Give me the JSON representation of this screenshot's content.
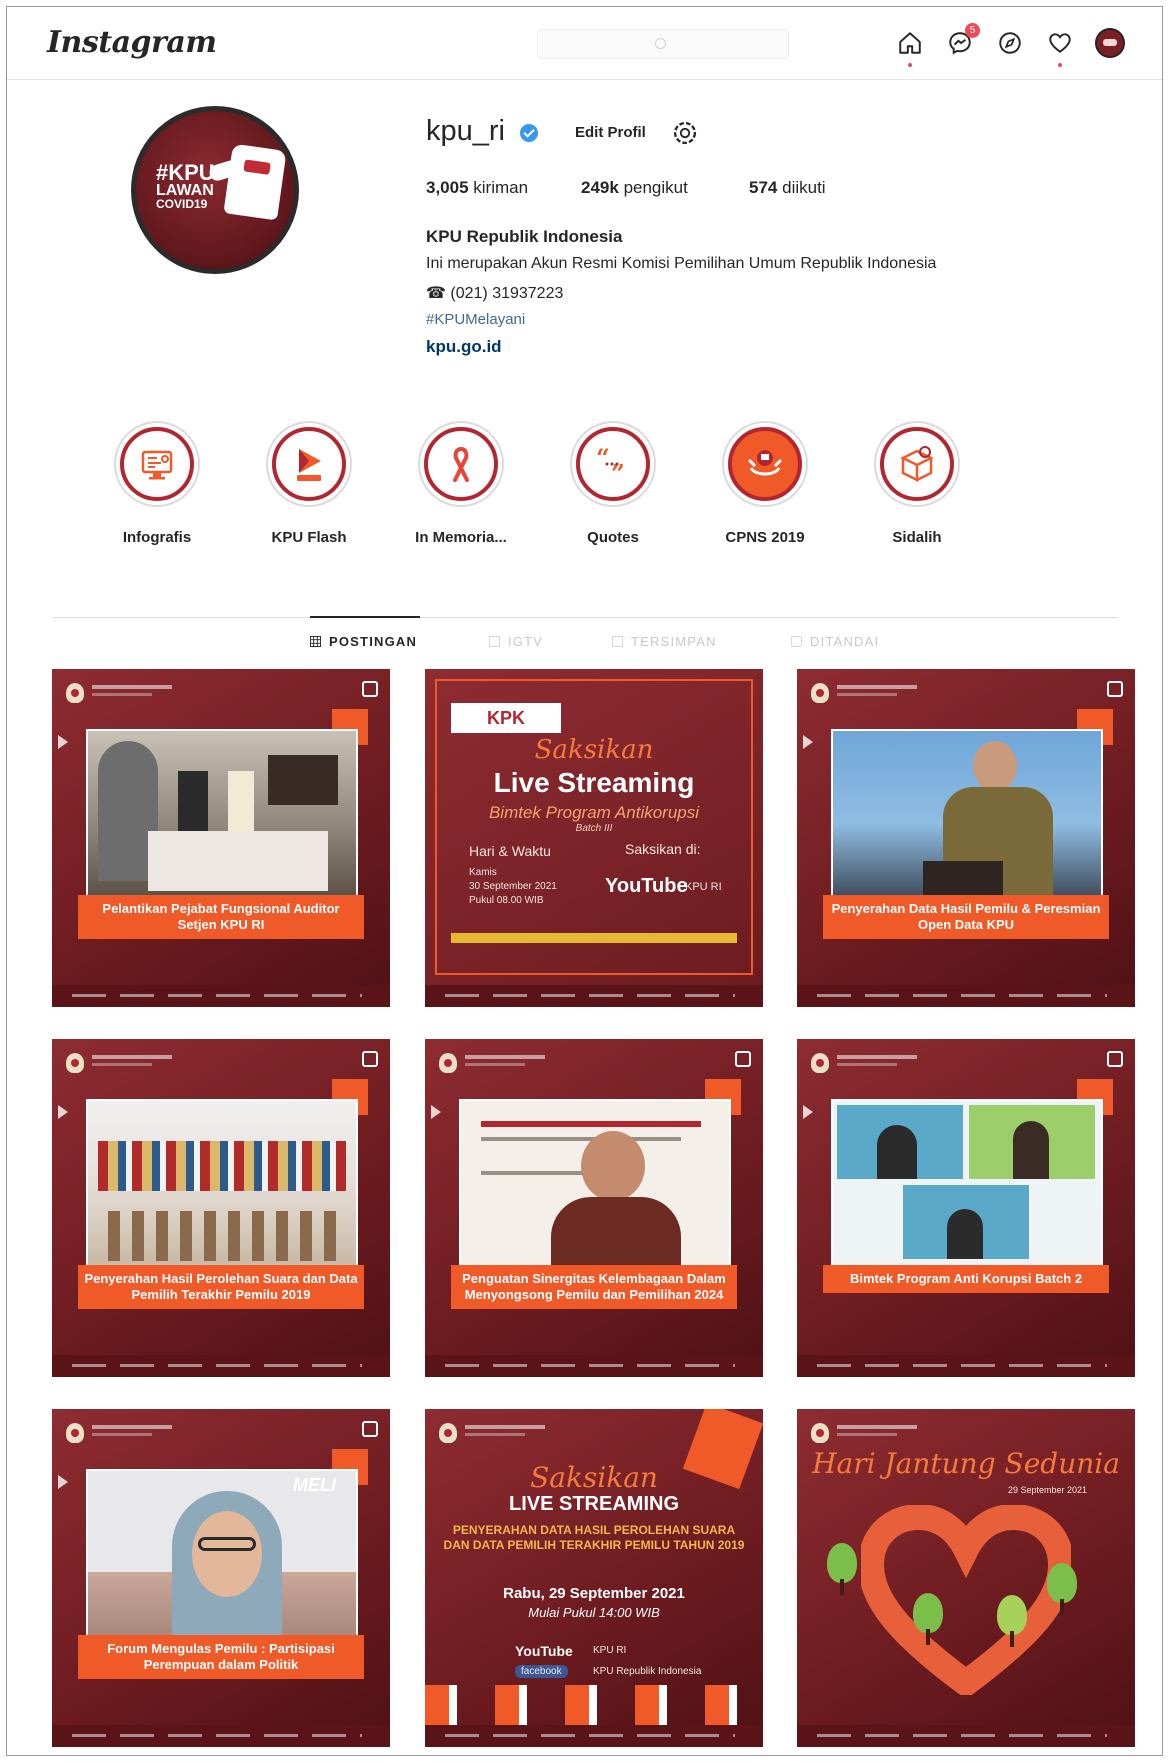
{
  "app": {
    "logo": "Instagram",
    "search_placeholder": ""
  },
  "nav": {
    "messages_badge": "5"
  },
  "profile": {
    "username": "kpu_ri",
    "edit_label": "Edit Profil",
    "avatar_lines": [
      "#KPU",
      "LAWAN",
      "COVID19"
    ],
    "posts_count": "3,005",
    "posts_label": "kiriman",
    "followers_count": "249k",
    "followers_label": "pengikut",
    "following_count": "574",
    "following_label": "diikuti",
    "name": "KPU Republik Indonesia",
    "description": "Ini merupakan Akun Resmi Komisi Pemilihan Umum Republik Indonesia",
    "phone": "(021) 31937223",
    "hashtag": "#KPUMelayani",
    "link": "kpu.go.id"
  },
  "highlights": [
    {
      "label": "Infografis",
      "icon": "infographic-icon"
    },
    {
      "label": "KPU Flash",
      "icon": "play-icon"
    },
    {
      "label": "In Memoria...",
      "icon": "ribbon-icon"
    },
    {
      "label": "Quotes",
      "icon": "quote-icon"
    },
    {
      "label": "CPNS 2019",
      "icon": "emblem-icon"
    },
    {
      "label": "Sidalih",
      "icon": "box-icon"
    }
  ],
  "tabs": [
    {
      "label": "POSTINGAN",
      "active": true
    },
    {
      "label": "IGTV",
      "active": false
    },
    {
      "label": "TERSIMPAN",
      "active": false
    },
    {
      "label": "DITANDAI",
      "active": false
    }
  ],
  "posts": {
    "p1": {
      "caption": "Pelantikan Pejabat Fungsional Auditor Setjen KPU RI"
    },
    "p2": {
      "brand": "KPK",
      "script": "Saksikan",
      "headline": "Live Streaming",
      "subtitle": "Bimtek Program Antikorupsi",
      "batch": "Batch III",
      "left_label": "Hari & Waktu",
      "right_label": "Saksikan di:",
      "day": "Kamis",
      "date": "30 September 2021",
      "time": "Pukul 08.00 WIB",
      "yt": "YouTube",
      "yt_channel": "KPU RI"
    },
    "p3": {
      "caption": "Penyerahan Data Hasil Pemilu & Peresmian Open Data KPU"
    },
    "p4": {
      "caption": "Penyerahan Hasil Perolehan Suara dan Data Pemilih Terakhir Pemilu 2019"
    },
    "p5": {
      "caption": "Penguatan Sinergitas Kelembagaan Dalam Menyongsong Pemilu dan Pemilihan 2024"
    },
    "p6": {
      "caption": "Bimtek Program Anti Korupsi Batch 2"
    },
    "p7": {
      "caption": "Forum Mengulas Pemilu : Partisipasi Perempuan dalam Politik",
      "overlay": "MELI"
    },
    "p8": {
      "script": "Saksikan",
      "headline": "LIVE STREAMING",
      "title": "PENYERAHAN DATA HASIL PEROLEHAN SUARA DAN DATA PEMILIH TERAKHIR PEMILU TAHUN 2019",
      "date": "Rabu, 29 September 2021",
      "time": "Mulai Pukul 14:00 WIB",
      "yt": "YouTube",
      "yt_channel": "KPU RI",
      "fb": "facebook",
      "fb_channel": "KPU Republik Indonesia"
    },
    "p9": {
      "title": "Hari Jantung Sedunia",
      "date": "29 September 2021"
    }
  },
  "colors": {
    "brand_red": "#b3262f",
    "orange": "#f05a28",
    "post_bg": "#7a2025"
  }
}
